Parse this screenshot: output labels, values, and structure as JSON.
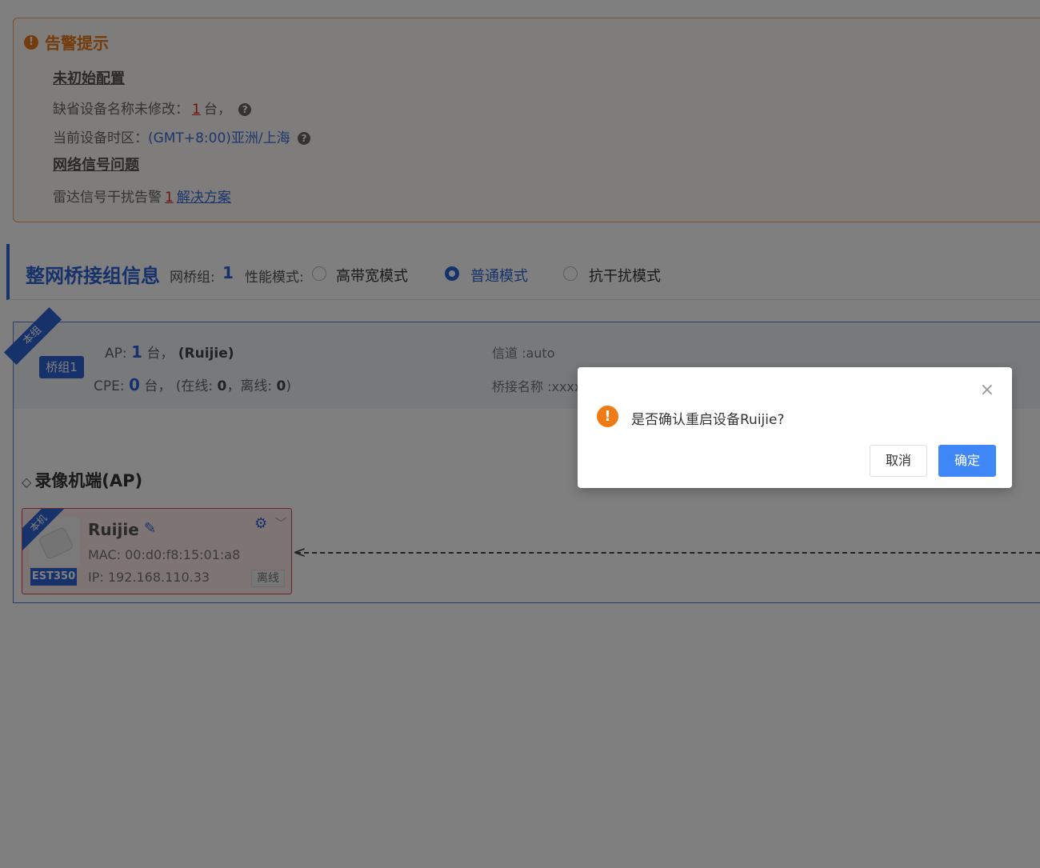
{
  "alert": {
    "icon": "!",
    "title": "告警提示",
    "section1_title": "未初始配置",
    "default_name_label": "缺省设备名称未修改：",
    "default_name_count": "1",
    "default_name_unit": "台，",
    "timezone_label": "当前设备时区：",
    "timezone_value": "(GMT+8:00)亚洲/上海",
    "section2_title": "网络信号问题",
    "radar_label": "雷达信号干扰告警",
    "radar_count": "1",
    "radar_link": "解决方案"
  },
  "bridge": {
    "title": "整网桥接组信息",
    "group_count_label": "网桥组:",
    "group_count": "1",
    "mode_label": "性能模式:",
    "modes": [
      {
        "label": "高带宽模式",
        "selected": false
      },
      {
        "label": "普通模式",
        "selected": true
      },
      {
        "label": "抗干扰模式",
        "selected": false
      }
    ]
  },
  "group": {
    "corner_tag": "本组",
    "badge": "桥组1",
    "ap_label": "AP:",
    "ap_count": "1",
    "ap_unit": "台，",
    "ap_name": "(Ruijie)",
    "cpe_label": "CPE:",
    "cpe_count": "0",
    "cpe_unit": "台，",
    "cpe_online_label": "(在线:",
    "cpe_online": "0",
    "cpe_offline_label": "，离线:",
    "cpe_offline": "0",
    "cpe_close": ")",
    "channel": "信道 :auto",
    "bridge_name": "桥接名称 :xxxx"
  },
  "ap_section": {
    "title": "录像机端(AP)",
    "diamond": "◇"
  },
  "device": {
    "tag": "本机",
    "model": "EST350",
    "name": "Ruijie",
    "mac_label": "MAC:",
    "mac": "00:d0:f8:15:01:a8",
    "ip_label": "IP:",
    "ip": "192.168.110.33",
    "status": "离线"
  },
  "modal": {
    "icon": "!",
    "message": "是否确认重启设备Ruijie?",
    "cancel": "取消",
    "ok": "确定",
    "close": "×"
  },
  "colors": {
    "primary": "#2f63d6",
    "warning": "#e8781a",
    "ok_button": "#3f86f7"
  }
}
